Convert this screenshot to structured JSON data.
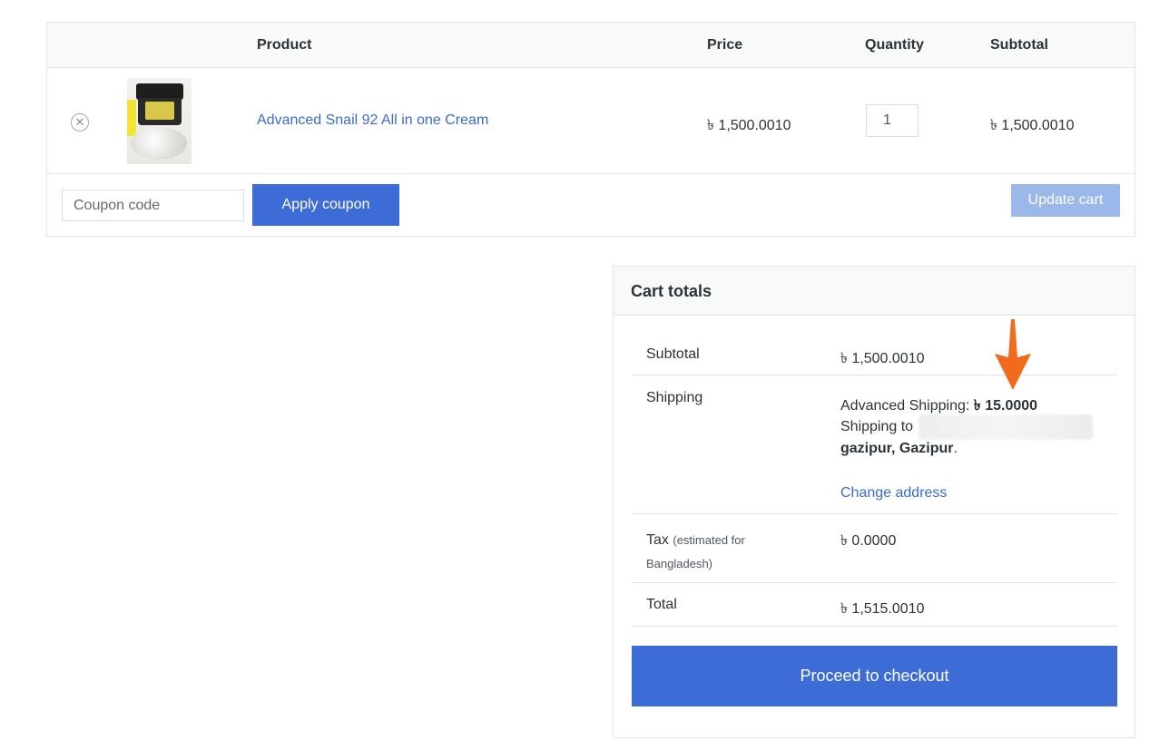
{
  "cart": {
    "headers": {
      "product": "Product",
      "price": "Price",
      "quantity": "Quantity",
      "subtotal": "Subtotal"
    },
    "items": [
      {
        "name": "Advanced Snail 92 All in one Cream",
        "price": "৳ 1,500.0010",
        "quantity": "1",
        "subtotal": "৳ 1,500.0010",
        "remove_icon": "close-circle-icon",
        "remove_glyph": "✕"
      }
    ],
    "coupon_placeholder": "Coupon code",
    "apply_coupon_label": "Apply coupon",
    "update_cart_label": "Update cart"
  },
  "totals": {
    "title": "Cart totals",
    "subtotal_label": "Subtotal",
    "subtotal_value": "৳ 1,500.0010",
    "shipping_label": "Shipping",
    "shipping_method": "Advanced Shipping: ",
    "shipping_cost": "৳ 15.0000",
    "shipping_to": "Shipping to",
    "shipping_city": "gazipur, Gazipur",
    "shipping_period": ".",
    "change_address": "Change address",
    "tax_label": "Tax",
    "tax_note_1": "(estimated for",
    "tax_note_2": "Bangladesh)",
    "tax_value": "৳ 0.0000",
    "total_label": "Total",
    "total_value": "৳ 1,515.0010",
    "checkout_label": "Proceed to checkout"
  },
  "colors": {
    "primary_button": "#3e6cd6",
    "disabled_button": "#9bb8ea",
    "link": "#3a6bd1",
    "annotation_arrow": "#f26b1d"
  },
  "annotation": {
    "icon": "arrow-down-icon"
  }
}
